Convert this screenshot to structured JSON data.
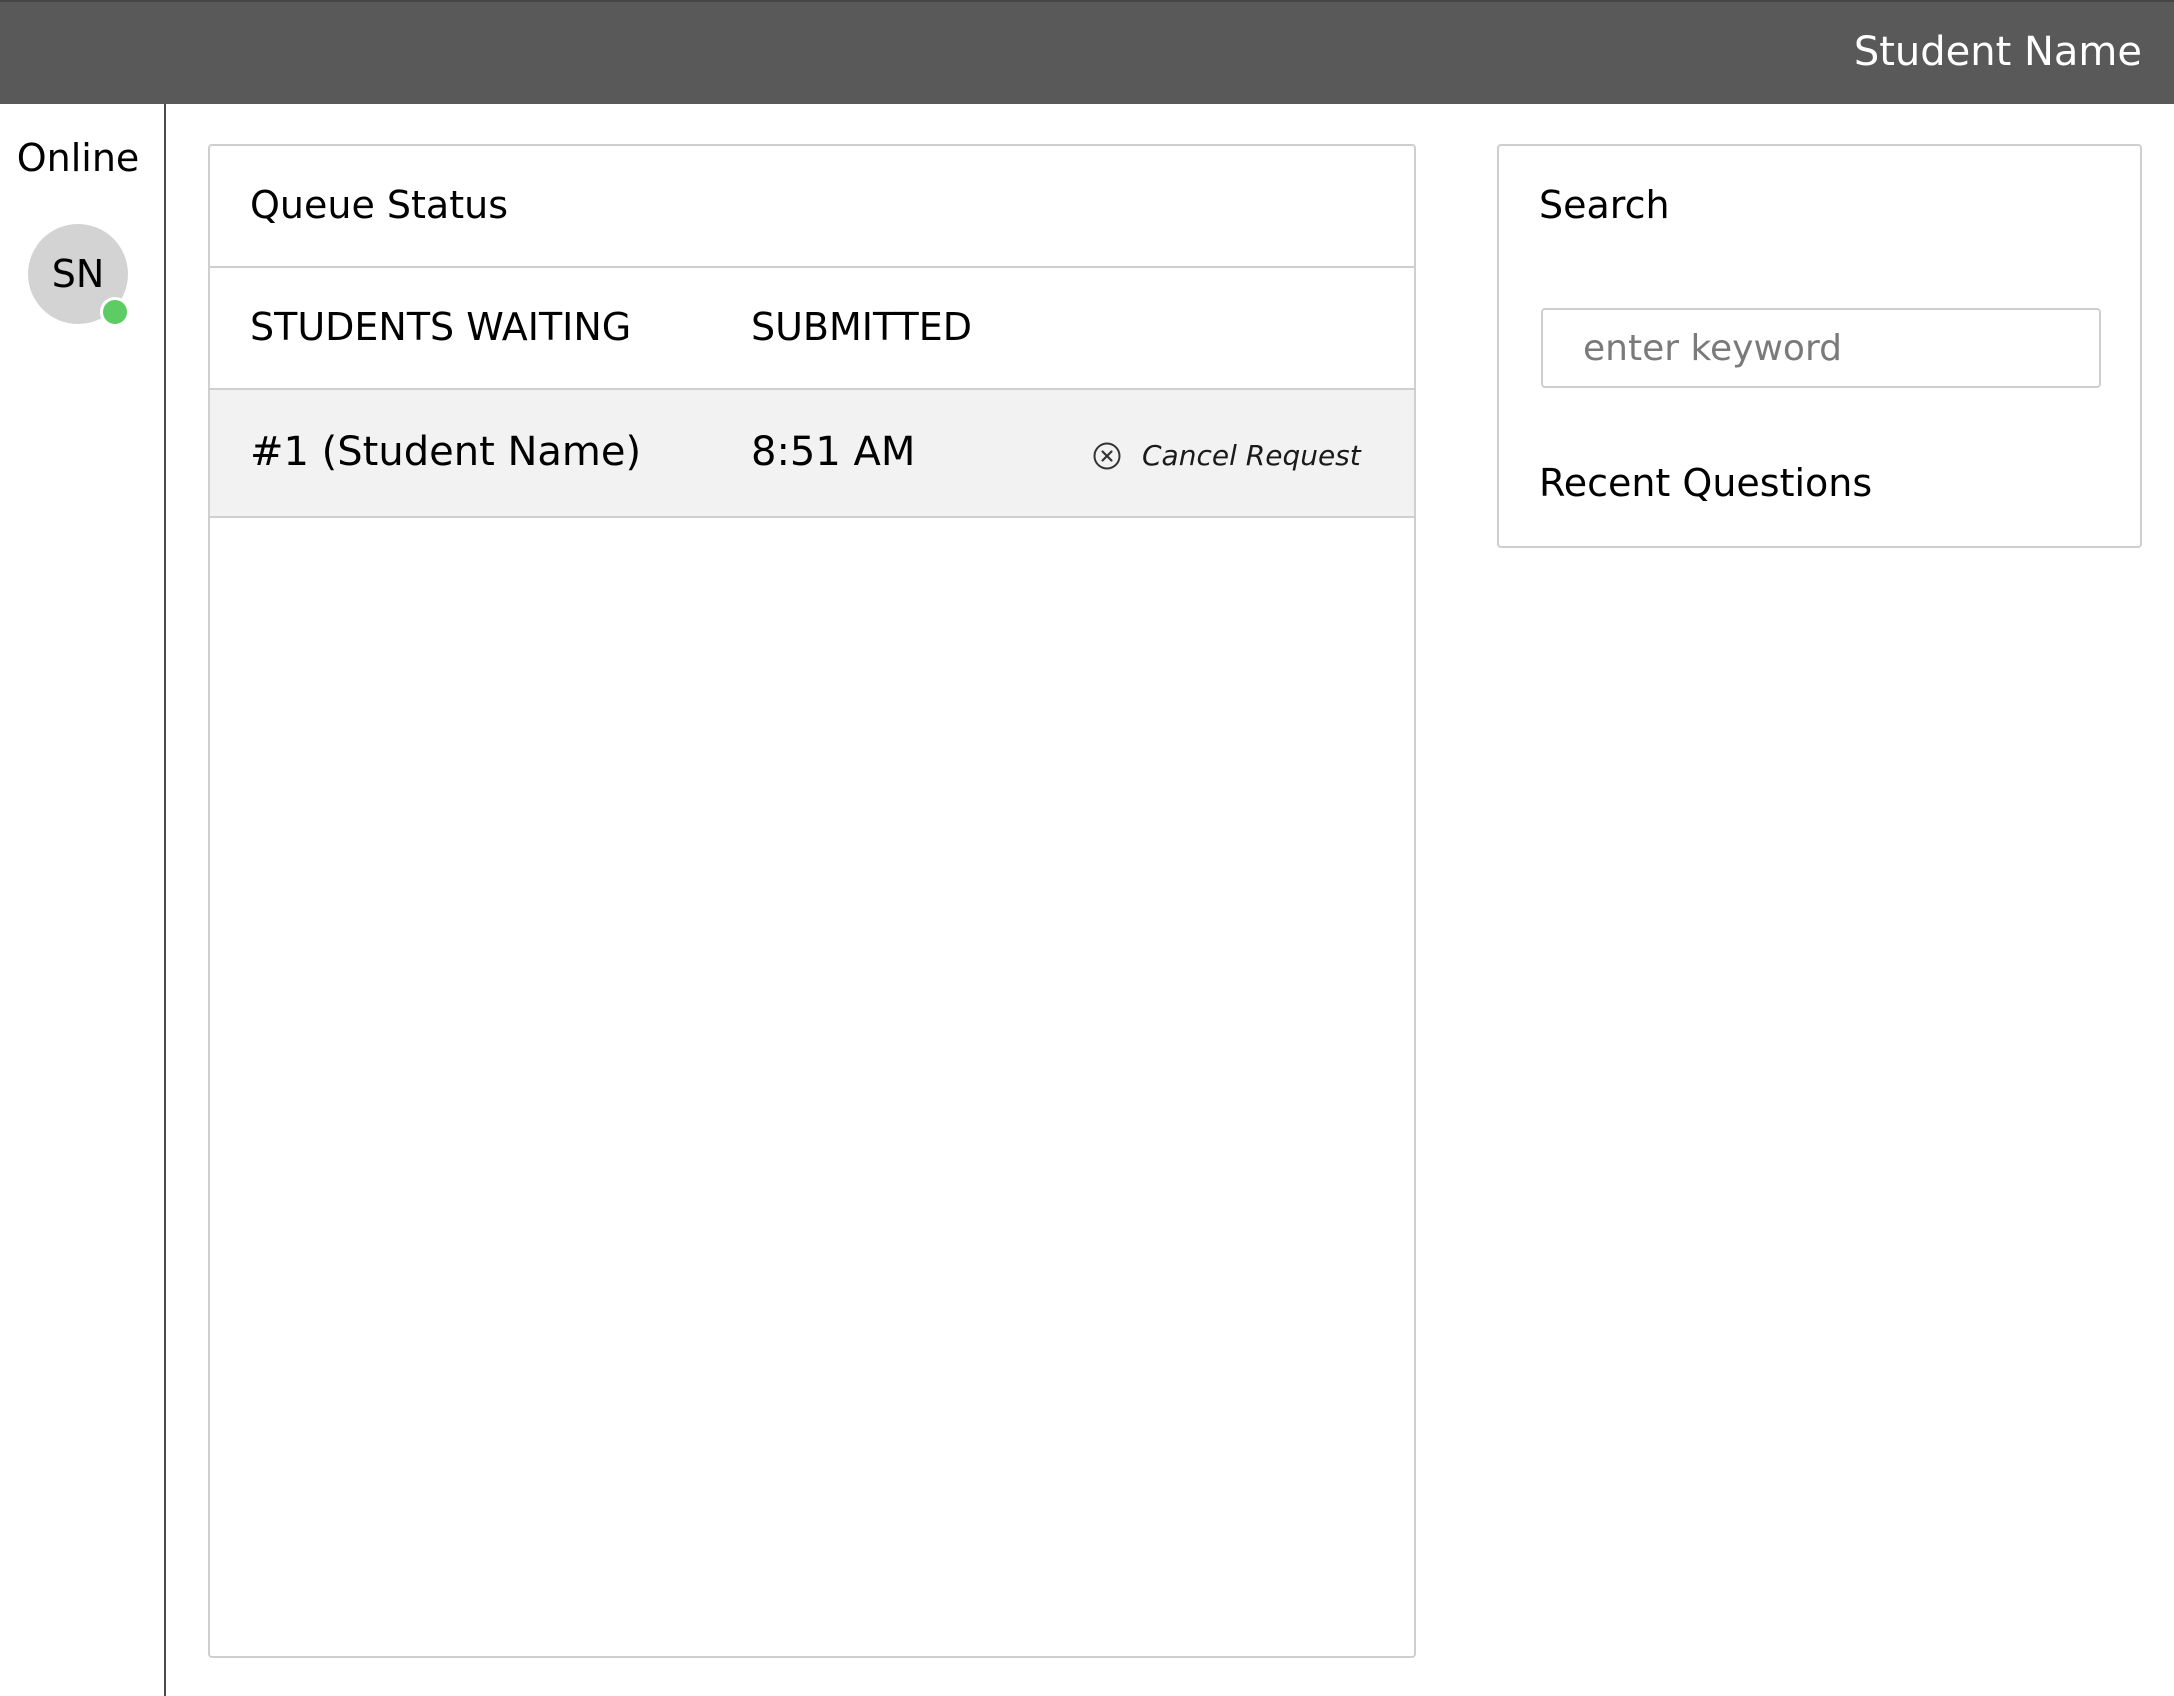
{
  "header": {
    "user_name": "Student Name"
  },
  "sidebar": {
    "status_label": "Online",
    "avatar_initials": "SN",
    "status_color": "#5ccc63"
  },
  "queue": {
    "title": "Queue Status",
    "columns": [
      "STUDENTS WAITING",
      "SUBMITTED"
    ],
    "rows": [
      {
        "position_name": "#1 (Student Name)",
        "submitted": "8:51 AM",
        "action_label": "Cancel Request",
        "action_icon": "circle-x-icon"
      }
    ]
  },
  "search": {
    "title": "Search",
    "placeholder": "enter keyword",
    "value": "",
    "recent_title": "Recent Questions"
  }
}
